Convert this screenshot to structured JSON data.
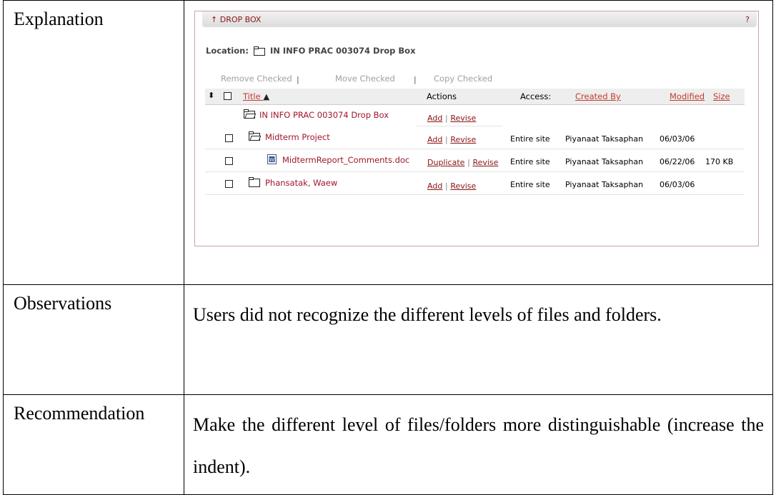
{
  "rows": {
    "explanation_label": "Explanation",
    "observations_label": "Observations",
    "observations_text": "Users did not recognize the different levels of files and folders.",
    "recommendation_label": "Recommendation",
    "recommendation_text": "Make the different level of files/folders more distinguishable (increase the indent)."
  },
  "dropbox": {
    "tab_arrow": "↑",
    "tab_title": "DROP BOX",
    "help": "?",
    "location_label": "Location:",
    "location_value": "IN INFO PRAC 003074 Drop Box",
    "remove_checked": "Remove Checked",
    "move_checked": "Move Checked",
    "copy_checked": "Copy Checked",
    "separator": "|",
    "sort_icon": "⬍",
    "columns": {
      "title": "Title",
      "actions": "Actions",
      "access": "Access:",
      "created_by": "Created By",
      "modified": "Modified",
      "size": "Size"
    },
    "items": [
      {
        "title": "IN INFO PRAC 003074 Drop Box",
        "action1": "Add",
        "action2": "Revise",
        "access": "",
        "created_by": "",
        "modified": "",
        "size": "",
        "icon": "folder-open-icon"
      },
      {
        "title": "Midterm Project",
        "action1": "Add",
        "action2": "Revise",
        "access": "Entire site",
        "created_by": "Piyanaat Taksaphan",
        "modified": "06/03/06",
        "size": "",
        "icon": "folder-open-icon"
      },
      {
        "title": "MidtermReport_Comments.doc",
        "action1": "Duplicate",
        "action2": "Revise",
        "access": "Entire site",
        "created_by": "Piyanaat Taksaphan",
        "modified": "06/22/06",
        "size": "170 KB",
        "icon": "word-document-icon"
      },
      {
        "title": "Phansatak, Waew",
        "action1": "Add",
        "action2": "Revise",
        "access": "Entire site",
        "created_by": "Piyanaat Taksaphan",
        "modified": "06/03/06",
        "size": "",
        "icon": "folder-closed-icon"
      }
    ]
  }
}
